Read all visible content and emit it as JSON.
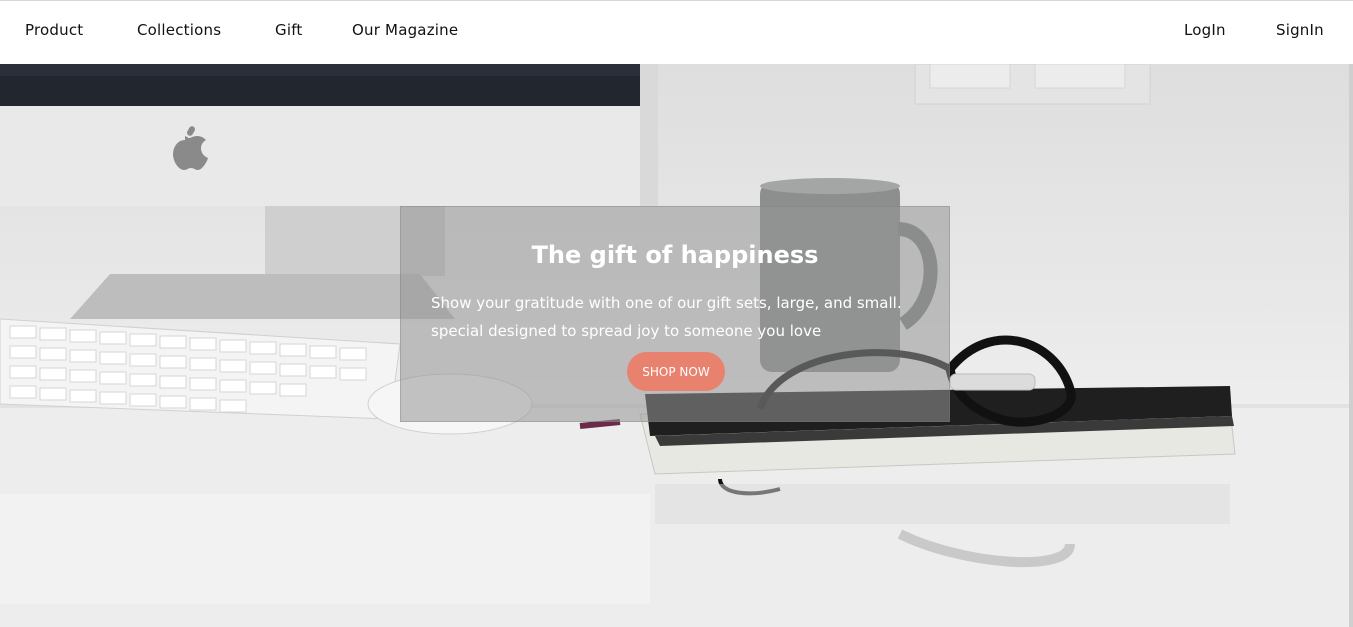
{
  "nav": {
    "left_links": [
      "Product",
      "Collections",
      "Gift",
      "Our Magazine"
    ],
    "right_links": [
      "LogIn",
      "SignIn"
    ]
  },
  "hero": {
    "title": "The gift of happiness",
    "text": "Show your gratitude with one of our gift sets, large, and small. special designed to spread joy to someone you love",
    "button_label": "SHOP NOW",
    "button_color": "#e8826f",
    "image": "desk-with-monitor-keyboard-mug-glasses-notebook"
  }
}
